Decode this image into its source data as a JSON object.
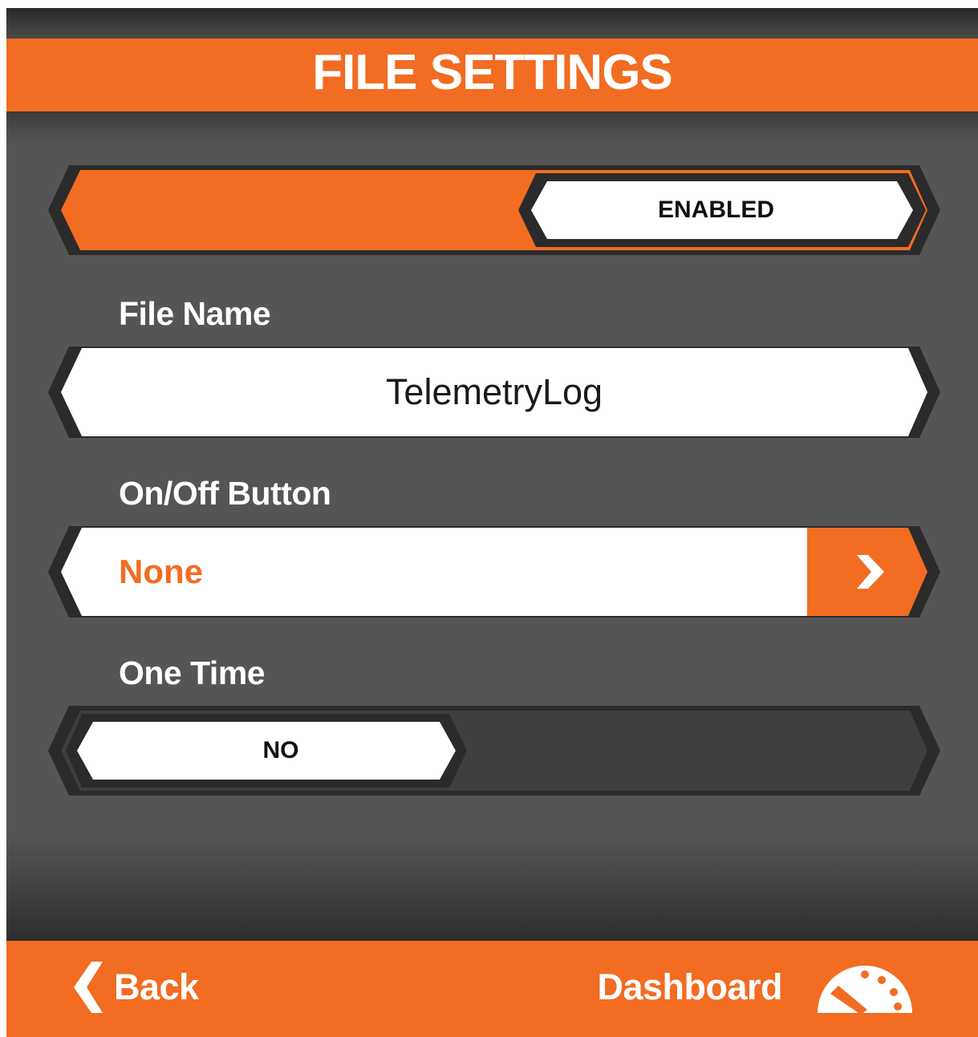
{
  "colors": {
    "accent": "#f26c22",
    "background": "#555555",
    "dark": "#2b2b2b",
    "white": "#ffffff"
  },
  "header": {
    "title": "FILE SETTINGS"
  },
  "enable_toggle": {
    "value": "ENABLED"
  },
  "file_name": {
    "label": "File Name",
    "value": "TelemetryLog"
  },
  "on_off_button": {
    "label": "On/Off Button",
    "value": "None"
  },
  "one_time": {
    "label": "One Time",
    "value": "NO"
  },
  "footer": {
    "back_label": "Back",
    "dashboard_label": "Dashboard",
    "back_icon": "chevron-left-icon",
    "dashboard_icon": "gauge-icon"
  }
}
